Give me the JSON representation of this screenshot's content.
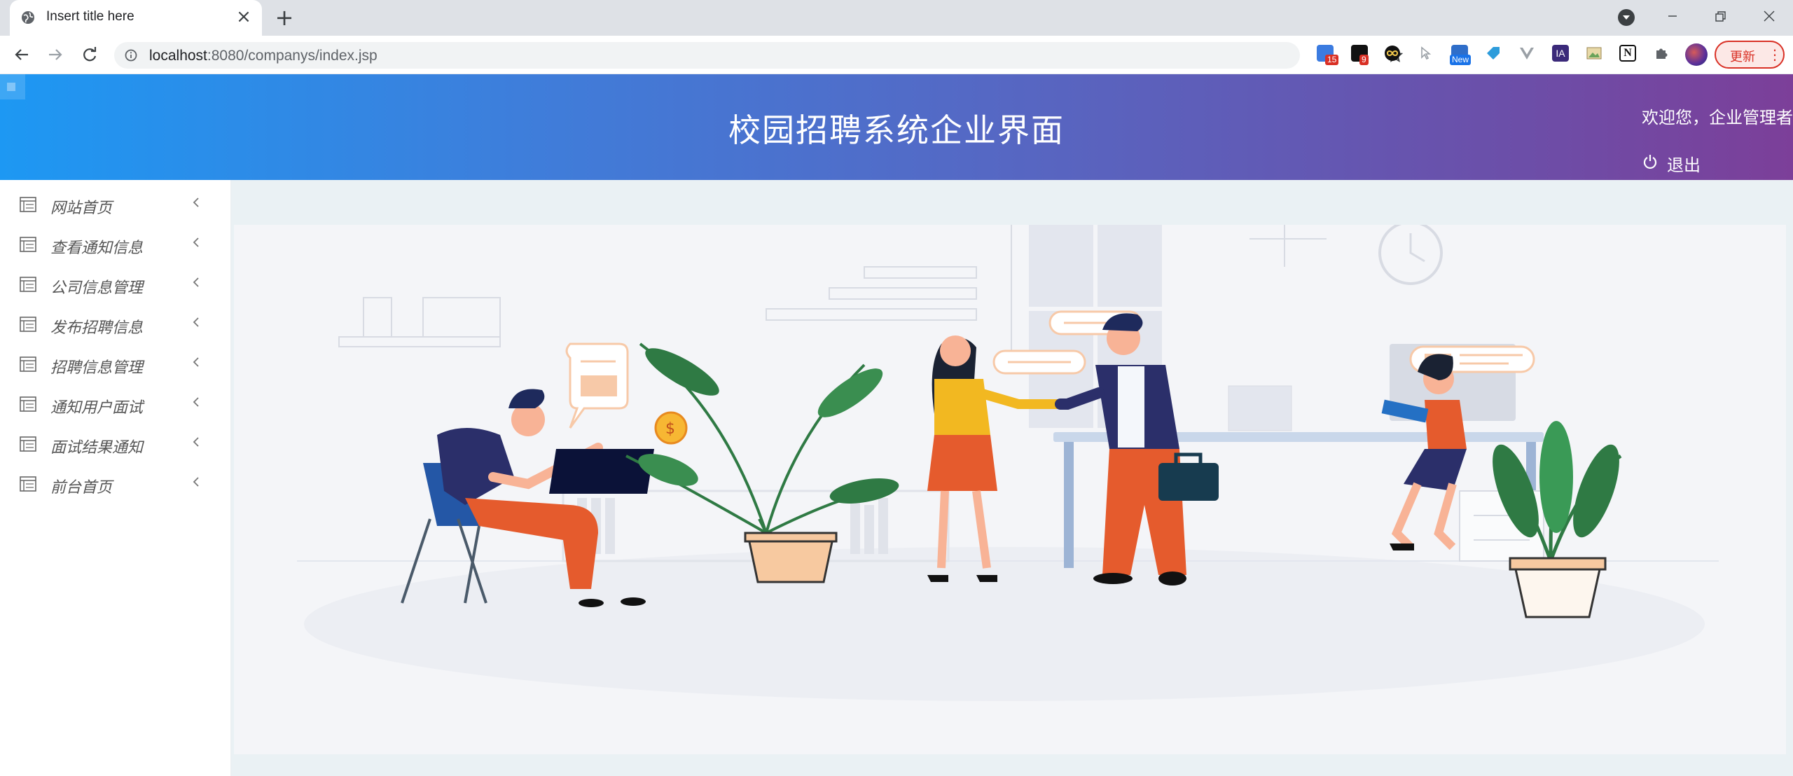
{
  "browser": {
    "tab_title": "Insert title here",
    "url_host": "localhost",
    "url_path": ":8080/companys/index.jsp",
    "extensions": [
      {
        "name": "puzzle-grid-extension",
        "badge": "15"
      },
      {
        "name": "camera-extension",
        "badge": "9"
      },
      {
        "name": "infinity-extension",
        "badge": ""
      },
      {
        "name": "cursor-extension",
        "badge": ""
      },
      {
        "name": "screenshot-extension",
        "badge": "New"
      },
      {
        "name": "tag-extension",
        "badge": ""
      },
      {
        "name": "vue-extension",
        "badge": ""
      },
      {
        "name": "ia-extension",
        "label": "IA"
      },
      {
        "name": "image-extension",
        "badge": ""
      },
      {
        "name": "notion-extension",
        "label": "N"
      }
    ],
    "update_label": "更新",
    "colors": {
      "tabstrip": "#dee1e6",
      "update": "#d93025"
    }
  },
  "header": {
    "title": "校园招聘系统企业界面",
    "welcome": "欢迎您，企业管理者",
    "logout_label": "退出",
    "gradient": [
      "#1d98f3",
      "#7c3f99"
    ]
  },
  "sidebar": {
    "items": [
      {
        "label": "网站首页"
      },
      {
        "label": "查看通知信息"
      },
      {
        "label": "公司信息管理"
      },
      {
        "label": "发布招聘信息"
      },
      {
        "label": "招聘信息管理"
      },
      {
        "label": "通知用户面试"
      },
      {
        "label": "面试结果通知"
      },
      {
        "label": "前台首页"
      }
    ]
  },
  "content": {
    "illustration": "office-handshake-illustration"
  }
}
